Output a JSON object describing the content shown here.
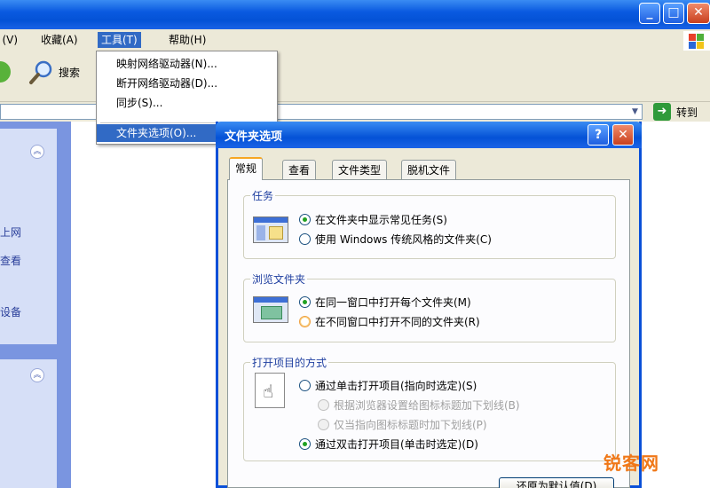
{
  "window": {
    "minimize_glyph": "_",
    "maximize_glyph": "□",
    "close_glyph": "✕"
  },
  "menubar": {
    "items": [
      {
        "label": ") (V)"
      },
      {
        "label": "收藏(A)"
      },
      {
        "label": "工具(T)"
      },
      {
        "label": "帮助(H)"
      }
    ]
  },
  "tools_menu": {
    "items": [
      {
        "label": "映射网络驱动器(N)..."
      },
      {
        "label": "断开网络驱动器(D)..."
      },
      {
        "label": "同步(S)..."
      },
      {
        "label": "文件夹选项(O)..."
      }
    ]
  },
  "toolbar": {
    "search_label": "搜索"
  },
  "addressbar": {
    "go_label": "转到"
  },
  "taskpane": {
    "links": [
      "上网",
      "查看",
      "设备"
    ]
  },
  "dialog": {
    "title": "文件夹选项",
    "help_glyph": "?",
    "close_glyph": "✕",
    "tabs": [
      "常规",
      "查看",
      "文件类型",
      "脱机文件"
    ],
    "active_tab": "常规",
    "groups": [
      {
        "label": "任务",
        "options": [
          {
            "label": "在文件夹中显示常见任务(S)",
            "selected": true
          },
          {
            "label": "使用 Windows 传统风格的文件夹(C)",
            "selected": false
          }
        ]
      },
      {
        "label": "浏览文件夹",
        "options": [
          {
            "label": "在同一窗口中打开每个文件夹(M)",
            "selected": true
          },
          {
            "label": "在不同窗口中打开不同的文件夹(R)",
            "selected": false
          }
        ]
      },
      {
        "label": "打开项目的方式",
        "options": [
          {
            "label": "通过单击打开项目(指向时选定)(S)",
            "selected": false
          },
          {
            "label": "根据浏览器设置给图标标题加下划线(B)",
            "selected": false,
            "disabled": true
          },
          {
            "label": "仅当指向图标标题时加下划线(P)",
            "selected": false,
            "disabled": true
          },
          {
            "label": "通过双击打开项目(单击时选定)(D)",
            "selected": true
          }
        ]
      }
    ],
    "restore_button": "还原为默认值(D)"
  },
  "watermark": "锐客网",
  "colors": {
    "xp_blue": "#0452d6",
    "menu_highlight": "#316ac5",
    "dialog_face": "#ece9d8",
    "taskpane": "#7a95e0",
    "watermark": "#f07818"
  }
}
